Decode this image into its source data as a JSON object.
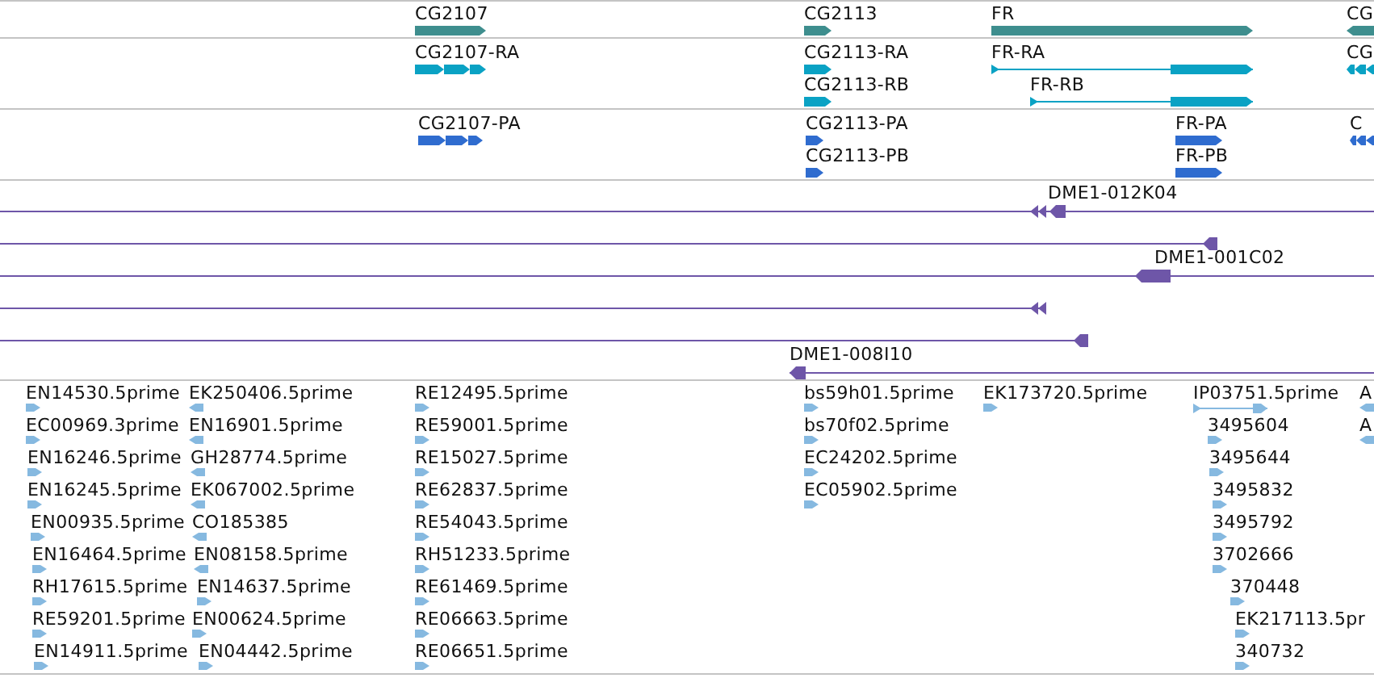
{
  "tracks": [
    {
      "kind": "genes",
      "features": [
        {
          "label": "CG2107",
          "kind": "block",
          "reverse": false
        },
        {
          "label": "CG2113",
          "kind": "block",
          "reverse": false
        },
        {
          "label": "FR",
          "kind": "block",
          "reverse": false
        },
        {
          "label": "CG",
          "kind": "block",
          "reverse": true
        }
      ]
    },
    {
      "kind": "transcripts",
      "features": [
        {
          "label": "CG2107-RA",
          "kind": "exons",
          "reverse": false
        },
        {
          "label": "CG2113-RA",
          "kind": "block",
          "reverse": false
        },
        {
          "label": "CG2113-RB",
          "kind": "block",
          "reverse": false
        },
        {
          "label": "FR-RA",
          "kind": "spliced",
          "reverse": false
        },
        {
          "label": "FR-RB",
          "kind": "spliced",
          "reverse": false
        },
        {
          "label": "CG",
          "kind": "exons",
          "reverse": true
        }
      ]
    },
    {
      "kind": "proteins",
      "features": [
        {
          "label": "CG2107-PA",
          "kind": "exons",
          "reverse": false
        },
        {
          "label": "CG2113-PA",
          "kind": "block",
          "reverse": false
        },
        {
          "label": "CG2113-PB",
          "kind": "block",
          "reverse": false
        },
        {
          "label": "FR-PA",
          "kind": "block",
          "reverse": false
        },
        {
          "label": "FR-PB",
          "kind": "block",
          "reverse": false
        },
        {
          "label": "C",
          "kind": "exons",
          "reverse": true
        }
      ]
    },
    {
      "kind": "clones",
      "features": [
        {
          "label": "DME1-012K04",
          "reverse": true
        },
        {
          "reverse": true
        },
        {
          "label": "DME1-001C02",
          "reverse": true
        },
        {
          "reverse": true
        },
        {
          "reverse": true
        },
        {
          "label": "DME1-008I10",
          "reverse": true
        }
      ]
    },
    {
      "kind": "ests",
      "features": [
        {
          "label": "EN14530.5prime",
          "kind": "flag",
          "reverse": false
        },
        {
          "label": "EC00969.3prime",
          "kind": "flag",
          "reverse": false
        },
        {
          "label": "EN16246.5prime",
          "kind": "flag",
          "reverse": false
        },
        {
          "label": "EN16245.5prime",
          "kind": "flag",
          "reverse": false
        },
        {
          "label": "EN00935.5prime",
          "kind": "flag",
          "reverse": false
        },
        {
          "label": "EN16464.5prime",
          "kind": "flag",
          "reverse": false
        },
        {
          "label": "RH17615.5prime",
          "kind": "flag",
          "reverse": false
        },
        {
          "label": "RE59201.5prime",
          "kind": "flag",
          "reverse": false
        },
        {
          "label": "EN14911.5prime",
          "kind": "flag",
          "reverse": false
        },
        {
          "label": "EK250406.5prime",
          "kind": "flag",
          "reverse": true
        },
        {
          "label": "EN16901.5prime",
          "kind": "flag",
          "reverse": true
        },
        {
          "label": "GH28774.5prime",
          "kind": "flag",
          "reverse": true
        },
        {
          "label": "EK067002.5prime",
          "kind": "flag",
          "reverse": true
        },
        {
          "label": "CO185385",
          "kind": "flag",
          "reverse": true
        },
        {
          "label": "EN08158.5prime",
          "kind": "flag",
          "reverse": true
        },
        {
          "label": "EN14637.5prime",
          "kind": "flag",
          "reverse": false
        },
        {
          "label": "EN00624.5prime",
          "kind": "flag",
          "reverse": false
        },
        {
          "label": "EN04442.5prime",
          "kind": "flag",
          "reverse": false
        },
        {
          "label": "RE12495.5prime",
          "kind": "flag",
          "reverse": false
        },
        {
          "label": "RE59001.5prime",
          "kind": "flag",
          "reverse": false
        },
        {
          "label": "RE15027.5prime",
          "kind": "flag",
          "reverse": false
        },
        {
          "label": "RE62837.5prime",
          "kind": "flag",
          "reverse": false
        },
        {
          "label": "RE54043.5prime",
          "kind": "flag",
          "reverse": false
        },
        {
          "label": "RH51233.5prime",
          "kind": "flag",
          "reverse": false
        },
        {
          "label": "RE61469.5prime",
          "kind": "flag",
          "reverse": false
        },
        {
          "label": "RE06663.5prime",
          "kind": "flag",
          "reverse": false
        },
        {
          "label": "RE06651.5prime",
          "kind": "flag",
          "reverse": false
        },
        {
          "label": "bs59h01.5prime",
          "kind": "flag",
          "reverse": false
        },
        {
          "label": "bs70f02.5prime",
          "kind": "flag",
          "reverse": false
        },
        {
          "label": "EC24202.5prime",
          "kind": "flag",
          "reverse": false
        },
        {
          "label": "EC05902.5prime",
          "kind": "flag",
          "reverse": false
        },
        {
          "label": "EK173720.5prime",
          "kind": "flag",
          "reverse": false
        },
        {
          "label": "IP03751.5prime",
          "kind": "spliced",
          "reverse": false
        },
        {
          "label": "3495604",
          "kind": "flag",
          "reverse": false
        },
        {
          "label": "3495644",
          "kind": "flag",
          "reverse": false
        },
        {
          "label": "3495832",
          "kind": "flag",
          "reverse": false
        },
        {
          "label": "3495792",
          "kind": "flag",
          "reverse": false
        },
        {
          "label": "3702666",
          "kind": "flag",
          "reverse": false
        },
        {
          "label": "370448",
          "kind": "flag",
          "reverse": false
        },
        {
          "label": "EK217113.5pr",
          "kind": "flag",
          "reverse": false
        },
        {
          "label": "340732",
          "kind": "flag",
          "reverse": false
        },
        {
          "label": "A",
          "kind": "flag",
          "reverse": true
        },
        {
          "label": "A",
          "kind": "flag",
          "reverse": true
        }
      ]
    }
  ]
}
